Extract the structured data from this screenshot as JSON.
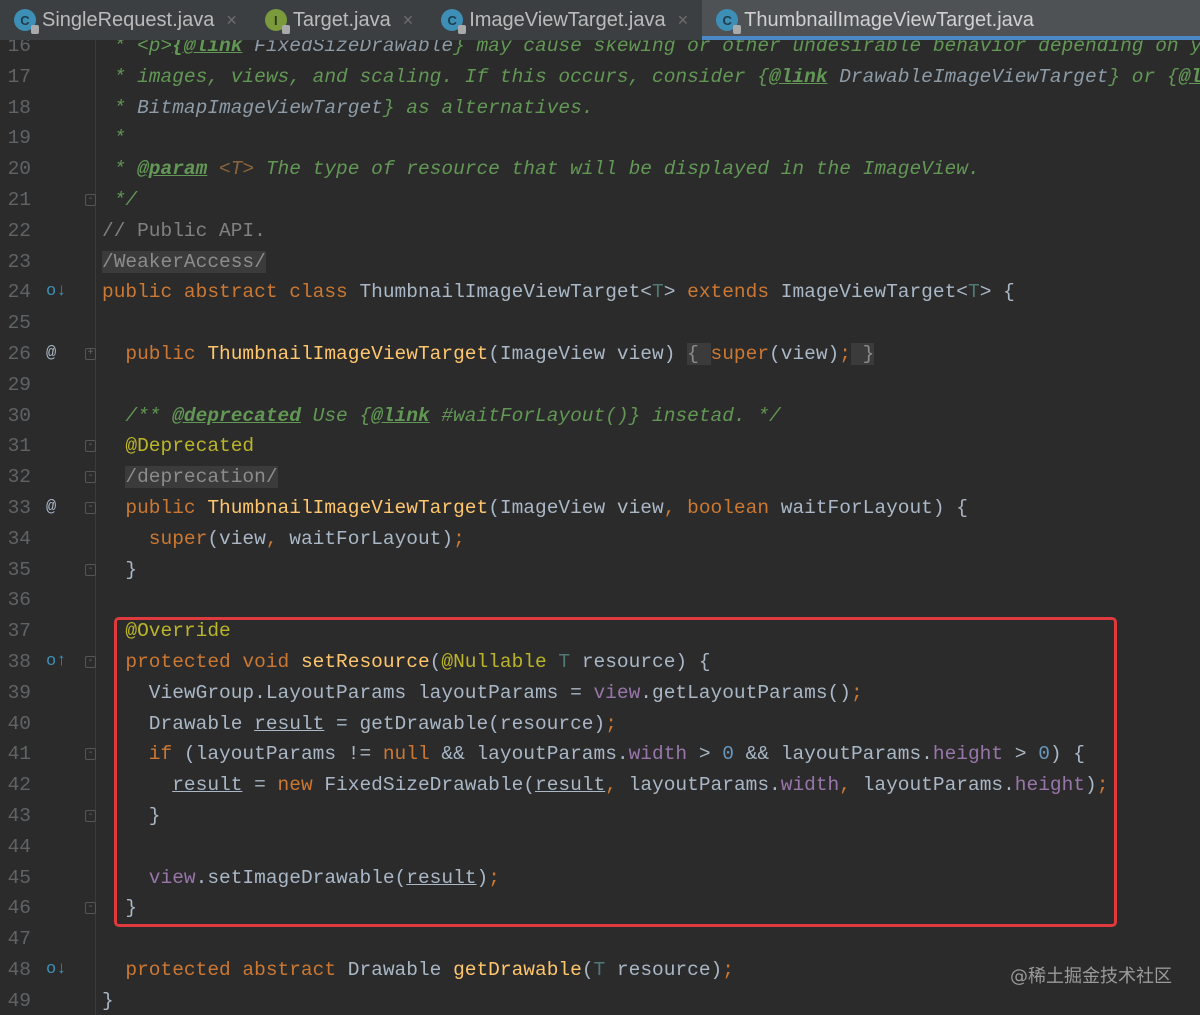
{
  "tabs": [
    {
      "label": "SingleRequest.java",
      "icon": "class-icon",
      "letter": "C",
      "active": false
    },
    {
      "label": "Target.java",
      "icon": "interface-icon",
      "letter": "I",
      "active": false
    },
    {
      "label": "ImageViewTarget.java",
      "icon": "class-icon",
      "letter": "C",
      "active": false
    },
    {
      "label": "ThumbnailImageViewTarget.java",
      "icon": "class-icon",
      "letter": "C",
      "active": true
    }
  ],
  "close_glyph": "×",
  "watermark": "@稀土掘金技术社区",
  "code": {
    "lines": [
      {
        "n": "16",
        "tokens": [
          [
            "c",
            " * <p>"
          ],
          [
            "d",
            "{@link"
          ],
          [
            "dl",
            " FixedSizeDrawable"
          ],
          [
            "c",
            "} may cause skewing or other undesirable behavior depending on y"
          ]
        ]
      },
      {
        "n": "17",
        "tokens": [
          [
            "c",
            " * images, views, and scaling. If this occurs, consider {"
          ],
          [
            "d",
            "@link"
          ],
          [
            "dl",
            " DrawableImageViewTarget"
          ],
          [
            "c",
            "} or {"
          ],
          [
            "d",
            "@l"
          ]
        ]
      },
      {
        "n": "18",
        "tokens": [
          [
            "c",
            " * "
          ],
          [
            "dl",
            "BitmapImageViewTarget"
          ],
          [
            "c",
            "} as alternatives."
          ]
        ]
      },
      {
        "n": "19",
        "tokens": [
          [
            "c",
            " *"
          ]
        ]
      },
      {
        "n": "20",
        "tokens": [
          [
            "c",
            " * "
          ],
          [
            "d",
            "@param"
          ],
          [
            "dt",
            " <T>"
          ],
          [
            "c",
            " The type of resource that will be displayed in the ImageView."
          ]
        ]
      },
      {
        "n": "21",
        "fold": "-",
        "tokens": [
          [
            "c",
            " */"
          ]
        ]
      },
      {
        "n": "22",
        "tokens": [
          [
            "lc",
            "// Public API."
          ]
        ]
      },
      {
        "n": "23",
        "tokens": [
          [
            "g",
            "/WeakerAccess/"
          ]
        ]
      },
      {
        "n": "24",
        "gutter": "o↓",
        "gclass": "impl",
        "tokens": [
          [
            "k",
            "public abstract class "
          ],
          [
            "p",
            "ThumbnailImageViewTarget<"
          ],
          [
            "t",
            "T"
          ],
          [
            "p",
            "> "
          ],
          [
            "k",
            "extends "
          ],
          [
            "p",
            "ImageViewTarget<"
          ],
          [
            "t",
            "T"
          ],
          [
            "p",
            "> {"
          ]
        ]
      },
      {
        "n": "25",
        "tokens": []
      },
      {
        "n": "26",
        "gutter": "@",
        "fold": "+",
        "tokens": [
          [
            "k",
            "  public "
          ],
          [
            "m",
            "ThumbnailImageViewTarget"
          ],
          [
            "p",
            "(ImageView view) "
          ],
          [
            "g",
            "{ "
          ],
          [
            "k",
            "super"
          ],
          [
            "p",
            "(view)"
          ],
          [
            "s",
            ";"
          ],
          [
            "g",
            " }"
          ]
        ]
      },
      {
        "n": "29",
        "tokens": []
      },
      {
        "n": "30",
        "tokens": [
          [
            "c",
            "  /** "
          ],
          [
            "d",
            "@deprecated"
          ],
          [
            "c",
            " Use {"
          ],
          [
            "d",
            "@link"
          ],
          [
            "c",
            " #waitForLayout()} insetad. */"
          ]
        ]
      },
      {
        "n": "31",
        "fold": "-",
        "tokens": [
          [
            "a",
            "  @Deprecated"
          ]
        ]
      },
      {
        "n": "32",
        "fold": "-",
        "tokens": [
          [
            "p",
            "  "
          ],
          [
            "g",
            "/deprecation/"
          ]
        ]
      },
      {
        "n": "33",
        "gutter": "@",
        "fold": "-",
        "tokens": [
          [
            "k",
            "  public "
          ],
          [
            "m",
            "ThumbnailImageViewTarget"
          ],
          [
            "p",
            "(ImageView view"
          ],
          [
            "s",
            ", "
          ],
          [
            "k",
            "boolean "
          ],
          [
            "p",
            "waitForLayout) {"
          ]
        ]
      },
      {
        "n": "34",
        "tokens": [
          [
            "k",
            "    super"
          ],
          [
            "p",
            "(view"
          ],
          [
            "s",
            ", "
          ],
          [
            "p",
            "waitForLayout)"
          ],
          [
            "s",
            ";"
          ]
        ]
      },
      {
        "n": "35",
        "fold": "-",
        "tokens": [
          [
            "p",
            "  }"
          ]
        ]
      },
      {
        "n": "36",
        "tokens": []
      },
      {
        "n": "37",
        "tokens": [
          [
            "a",
            "  @Override"
          ]
        ]
      },
      {
        "n": "38",
        "gutter": "o↑",
        "gclass": "impl",
        "fold": "-",
        "tokens": [
          [
            "k",
            "  protected void "
          ],
          [
            "m",
            "setResource"
          ],
          [
            "p",
            "("
          ],
          [
            "a",
            "@Nullable "
          ],
          [
            "t",
            "T "
          ],
          [
            "p",
            "resource) {"
          ]
        ]
      },
      {
        "n": "39",
        "tokens": [
          [
            "p",
            "    ViewGroup.LayoutParams layoutParams = "
          ],
          [
            "f",
            "view"
          ],
          [
            "p",
            ".getLayoutParams()"
          ],
          [
            "s",
            ";"
          ]
        ]
      },
      {
        "n": "40",
        "tokens": [
          [
            "p",
            "    Drawable "
          ],
          [
            "u",
            "result"
          ],
          [
            "p",
            " = getDrawable(resource)"
          ],
          [
            "s",
            ";"
          ]
        ]
      },
      {
        "n": "41",
        "fold": "-",
        "tokens": [
          [
            "k",
            "    if "
          ],
          [
            "p",
            "(layoutParams != "
          ],
          [
            "k",
            "null "
          ],
          [
            "p",
            "&& layoutParams."
          ],
          [
            "f",
            "width"
          ],
          [
            "p",
            " > "
          ],
          [
            "n",
            "0"
          ],
          [
            "p",
            " && layoutParams."
          ],
          [
            "f",
            "height"
          ],
          [
            "p",
            " > "
          ],
          [
            "n",
            "0"
          ],
          [
            "p",
            ") {"
          ]
        ]
      },
      {
        "n": "42",
        "tokens": [
          [
            "p",
            "      "
          ],
          [
            "u",
            "result"
          ],
          [
            "p",
            " = "
          ],
          [
            "k",
            "new "
          ],
          [
            "p",
            "FixedSizeDrawable("
          ],
          [
            "u",
            "result"
          ],
          [
            "s",
            ", "
          ],
          [
            "p",
            "layoutParams."
          ],
          [
            "f",
            "width"
          ],
          [
            "s",
            ", "
          ],
          [
            "p",
            "layoutParams."
          ],
          [
            "f",
            "height"
          ],
          [
            "p",
            ")"
          ],
          [
            "s",
            ";"
          ]
        ]
      },
      {
        "n": "43",
        "fold": "-",
        "tokens": [
          [
            "p",
            "    }"
          ]
        ]
      },
      {
        "n": "44",
        "tokens": []
      },
      {
        "n": "45",
        "tokens": [
          [
            "f",
            "    view"
          ],
          [
            "p",
            ".setImageDrawable("
          ],
          [
            "u",
            "result"
          ],
          [
            "p",
            ")"
          ],
          [
            "s",
            ";"
          ]
        ]
      },
      {
        "n": "46",
        "fold": "-",
        "tokens": [
          [
            "p",
            "  }"
          ]
        ]
      },
      {
        "n": "47",
        "tokens": []
      },
      {
        "n": "48",
        "gutter": "o↓",
        "gclass": "impl",
        "tokens": [
          [
            "k",
            "  protected abstract "
          ],
          [
            "p",
            "Drawable "
          ],
          [
            "m",
            "getDrawable"
          ],
          [
            "p",
            "("
          ],
          [
            "t",
            "T "
          ],
          [
            "p",
            "resource)"
          ],
          [
            "s",
            ";"
          ]
        ]
      },
      {
        "n": "49",
        "tokens": [
          [
            "p",
            "}"
          ]
        ]
      }
    ]
  }
}
